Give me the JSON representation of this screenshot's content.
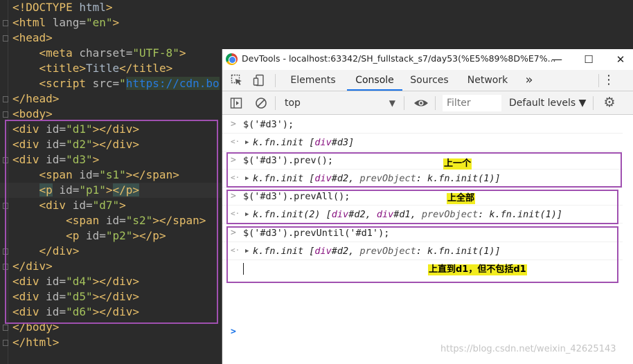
{
  "editor": {
    "lines": [
      {
        "parts": [
          {
            "c": "t-tag",
            "t": "<!DOCTYPE "
          },
          {
            "c": "t-text",
            "t": "html"
          },
          {
            "c": "t-tag",
            "t": ">"
          }
        ]
      },
      {
        "parts": [
          {
            "c": "t-tag",
            "t": "<html "
          },
          {
            "c": "t-attr",
            "t": "lang="
          },
          {
            "c": "t-val",
            "t": "\"en\""
          },
          {
            "c": "t-tag",
            "t": ">"
          }
        ]
      },
      {
        "parts": [
          {
            "c": "t-tag",
            "t": "<head>"
          }
        ]
      },
      {
        "parts": [
          {
            "c": "t-text",
            "t": "    "
          },
          {
            "c": "t-tag",
            "t": "<meta "
          },
          {
            "c": "t-attr",
            "t": "charset="
          },
          {
            "c": "t-val",
            "t": "\"UTF-8\""
          },
          {
            "c": "t-tag",
            "t": ">"
          }
        ]
      },
      {
        "parts": [
          {
            "c": "t-text",
            "t": "    "
          },
          {
            "c": "t-tag",
            "t": "<title>"
          },
          {
            "c": "t-text",
            "t": "Title"
          },
          {
            "c": "t-tag",
            "t": "</title>"
          }
        ]
      },
      {
        "parts": [
          {
            "c": "t-text",
            "t": "    "
          },
          {
            "c": "t-tag",
            "t": "<script "
          },
          {
            "c": "t-attr",
            "t": "src="
          },
          {
            "c": "t-val",
            "t": "\""
          },
          {
            "c": "t-url",
            "t": "https://cdn.bo"
          }
        ]
      },
      {
        "parts": [
          {
            "c": "t-tag",
            "t": "</head>"
          }
        ]
      },
      {
        "parts": [
          {
            "c": "t-tag",
            "t": "<body>"
          }
        ]
      },
      {
        "parts": [
          {
            "c": "t-tag",
            "t": "<div "
          },
          {
            "c": "t-attr",
            "t": "id="
          },
          {
            "c": "t-val",
            "t": "\"d1\""
          },
          {
            "c": "t-tag",
            "t": "></div>"
          }
        ]
      },
      {
        "parts": [
          {
            "c": "t-tag",
            "t": "<div "
          },
          {
            "c": "t-attr",
            "t": "id="
          },
          {
            "c": "t-val",
            "t": "\"d2\""
          },
          {
            "c": "t-tag",
            "t": "></div>"
          }
        ]
      },
      {
        "parts": [
          {
            "c": "t-tag",
            "t": "<div "
          },
          {
            "c": "t-attr",
            "t": "id="
          },
          {
            "c": "t-val",
            "t": "\"d3\""
          },
          {
            "c": "t-tag",
            "t": ">"
          }
        ]
      },
      {
        "parts": [
          {
            "c": "t-text",
            "t": "    "
          },
          {
            "c": "t-tag",
            "t": "<span "
          },
          {
            "c": "t-attr",
            "t": "id="
          },
          {
            "c": "t-val",
            "t": "\"s1\""
          },
          {
            "c": "t-tag",
            "t": "></span>"
          }
        ]
      },
      {
        "parts": [
          {
            "c": "t-text",
            "t": "    "
          },
          {
            "c": "t-tag match",
            "t": "<p"
          },
          {
            "c": "t-tag",
            "t": " "
          },
          {
            "c": "t-attr",
            "t": "id="
          },
          {
            "c": "t-val",
            "t": "\"p1\""
          },
          {
            "c": "t-tag",
            "t": ">"
          },
          {
            "c": "t-tag match",
            "t": "</p>"
          }
        ]
      },
      {
        "parts": [
          {
            "c": "t-text",
            "t": "    "
          },
          {
            "c": "t-tag",
            "t": "<div "
          },
          {
            "c": "t-attr",
            "t": "id="
          },
          {
            "c": "t-val",
            "t": "\"d7\""
          },
          {
            "c": "t-tag",
            "t": ">"
          }
        ]
      },
      {
        "parts": [
          {
            "c": "t-text",
            "t": "        "
          },
          {
            "c": "t-tag",
            "t": "<span "
          },
          {
            "c": "t-attr",
            "t": "id="
          },
          {
            "c": "t-val",
            "t": "\"s2\""
          },
          {
            "c": "t-tag",
            "t": "></span>"
          }
        ]
      },
      {
        "parts": [
          {
            "c": "t-text",
            "t": "        "
          },
          {
            "c": "t-tag",
            "t": "<p "
          },
          {
            "c": "t-attr",
            "t": "id="
          },
          {
            "c": "t-val",
            "t": "\"p2\""
          },
          {
            "c": "t-tag",
            "t": "></p>"
          }
        ]
      },
      {
        "parts": [
          {
            "c": "t-text",
            "t": "    "
          },
          {
            "c": "t-tag",
            "t": "</div>"
          }
        ]
      },
      {
        "parts": [
          {
            "c": "t-tag",
            "t": "</div>"
          }
        ]
      },
      {
        "parts": [
          {
            "c": "t-tag",
            "t": "<div "
          },
          {
            "c": "t-attr",
            "t": "id="
          },
          {
            "c": "t-val",
            "t": "\"d4\""
          },
          {
            "c": "t-tag",
            "t": "></div>"
          }
        ]
      },
      {
        "parts": [
          {
            "c": "t-tag",
            "t": "<div "
          },
          {
            "c": "t-attr",
            "t": "id="
          },
          {
            "c": "t-val",
            "t": "\"d5\""
          },
          {
            "c": "t-tag",
            "t": "></div>"
          }
        ]
      },
      {
        "parts": [
          {
            "c": "t-tag",
            "t": "<div "
          },
          {
            "c": "t-attr",
            "t": "id="
          },
          {
            "c": "t-val",
            "t": "\"d6\""
          },
          {
            "c": "t-tag",
            "t": "></div>"
          }
        ]
      },
      {
        "parts": [
          {
            "c": "t-tag",
            "t": "</body>"
          }
        ]
      },
      {
        "parts": [
          {
            "c": "t-tag",
            "t": "</html>"
          }
        ]
      }
    ]
  },
  "devtools": {
    "window_title": "DevTools - localhost:63342/SH_fullstack_s7/day53(%E5%89%8D%E7%...",
    "min_glyph": "—",
    "max_glyph": "☐",
    "close_glyph": "✕",
    "tabs": [
      "Elements",
      "Console",
      "Sources",
      "Network"
    ],
    "active_tab": "Console",
    "more_tabs_glyph": "»",
    "menu_glyph": "⋮",
    "context": "top",
    "filter_placeholder": "Filter",
    "levels_label": "Default levels ▼",
    "gear_glyph": "⚙"
  },
  "console": {
    "entries": [
      {
        "input": "$('#d3');",
        "output": [
          {
            "c": "",
            "t": "k.fn.init ["
          },
          {
            "c": "s-purple",
            "t": "div"
          },
          {
            "c": "",
            "t": "#d3]"
          }
        ]
      },
      {
        "input": "$('#d3').prev();",
        "output": [
          {
            "c": "",
            "t": "k.fn.init ["
          },
          {
            "c": "s-purple",
            "t": "div"
          },
          {
            "c": "",
            "t": "#d2, "
          },
          {
            "c": "s-key",
            "t": "prevObject"
          },
          {
            "c": "",
            "t": ": k.fn.init(1)]"
          }
        ]
      },
      {
        "input": "$('#d3').prevAll();",
        "output": [
          {
            "c": "",
            "t": "k.fn.init(2) ["
          },
          {
            "c": "s-purple",
            "t": "div"
          },
          {
            "c": "",
            "t": "#d2, "
          },
          {
            "c": "s-purple",
            "t": "div"
          },
          {
            "c": "",
            "t": "#d1, "
          },
          {
            "c": "s-key",
            "t": "prevObject"
          },
          {
            "c": "",
            "t": ": k.fn.init(1)]"
          }
        ]
      },
      {
        "input": "$('#d3').prevUntil('#d1');",
        "output": [
          {
            "c": "",
            "t": "k.fn.init ["
          },
          {
            "c": "s-purple",
            "t": "div"
          },
          {
            "c": "",
            "t": "#d2, "
          },
          {
            "c": "s-key",
            "t": "prevObject"
          },
          {
            "c": "",
            "t": ": k.fn.init(1)]"
          }
        ]
      }
    ],
    "input_prompt": ">",
    "output_prompt": "<·",
    "expand_glyph": "▶"
  },
  "annotations": {
    "prev": "上一个",
    "prevAll": "上全部",
    "prevUntil": "上直到d1，但不包括d1"
  },
  "watermark": "https://blog.csdn.net/weixin_42625143",
  "colors": {
    "annotation_box": "#a050b0",
    "annotation_label_bg": "#f2ec1e",
    "active_tab_underline": "#1a73e8"
  }
}
